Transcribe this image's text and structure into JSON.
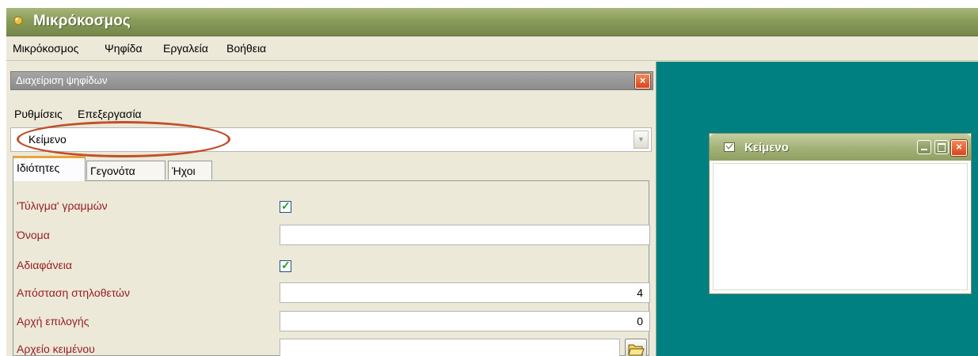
{
  "app": {
    "title": "Μικρόκοσμος",
    "title_color": "#8a9c5a",
    "desktop_color": "#008080"
  },
  "menubar": {
    "items": [
      "Μικρόκοσμος",
      "Ψηφίδα",
      "Εργαλεία",
      "Βοήθεια"
    ]
  },
  "tool_window": {
    "title": "Διαχείριση ψηφίδων",
    "close_icon": "close-icon",
    "menu": [
      "Ρυθμίσεις",
      "Επεξεργασία"
    ],
    "selected_object": "Κείμενο",
    "tabs": [
      "Ιδιότητες",
      "Γεγονότα",
      "Ήχοι"
    ],
    "active_tab": "Ιδιότητες",
    "properties": [
      {
        "label": "'Τύλιγμα' γραμμών",
        "type": "checkbox",
        "checked": true
      },
      {
        "label": "Όνομα",
        "type": "text",
        "value": ""
      },
      {
        "label": "Αδιαφάνεια",
        "type": "checkbox",
        "checked": true
      },
      {
        "label": "Απόσταση στηλοθετών",
        "type": "text",
        "value": "4"
      },
      {
        "label": "Αρχή επιλογής",
        "type": "text",
        "value": "0"
      },
      {
        "label": "Αρχείο κειμένου",
        "type": "file",
        "value": ""
      }
    ],
    "label_color": "#9a1c22",
    "highlight_color": "#c1502a"
  },
  "child_window": {
    "title": "Κείμενο"
  }
}
